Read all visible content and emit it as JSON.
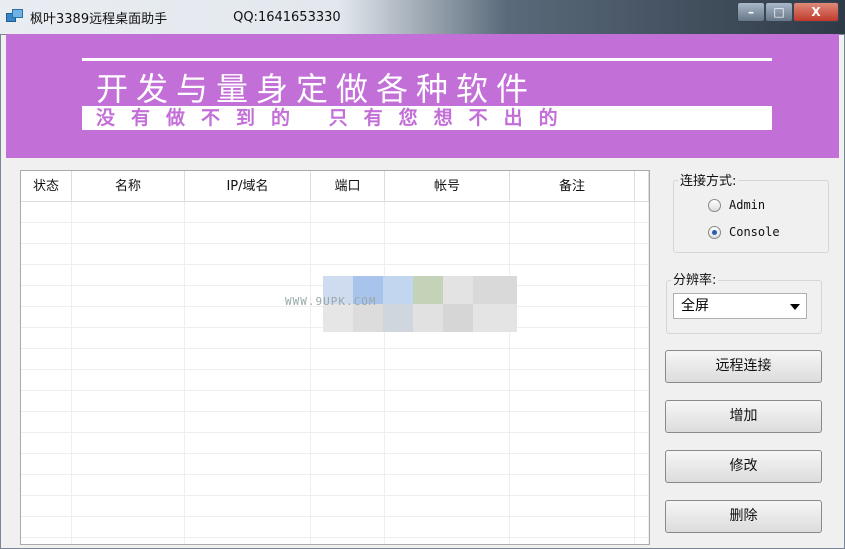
{
  "window": {
    "title": "枫叶3389远程桌面助手",
    "qq": "QQ:1641653330",
    "min_label": "–",
    "max_label": "□",
    "close_label": "X"
  },
  "banner": {
    "title": "开发与量身定做各种软件",
    "subtitle": "没有做不到的 只有您想不出的",
    "bg_color": "#c36fd8"
  },
  "table": {
    "columns": [
      "状态",
      "名称",
      "IP/域名",
      "端口",
      "帐号",
      "备注"
    ],
    "rows": []
  },
  "watermark": "WWW.9UPK.COM",
  "connection": {
    "label": "连接方式:",
    "options": [
      {
        "label": "Admin",
        "selected": false
      },
      {
        "label": "Console",
        "selected": true
      }
    ]
  },
  "resolution": {
    "label": "分辨率:",
    "selected": "全屏"
  },
  "buttons": {
    "connect": "远程连接",
    "add": "增加",
    "edit": "修改",
    "delete": "删除"
  }
}
